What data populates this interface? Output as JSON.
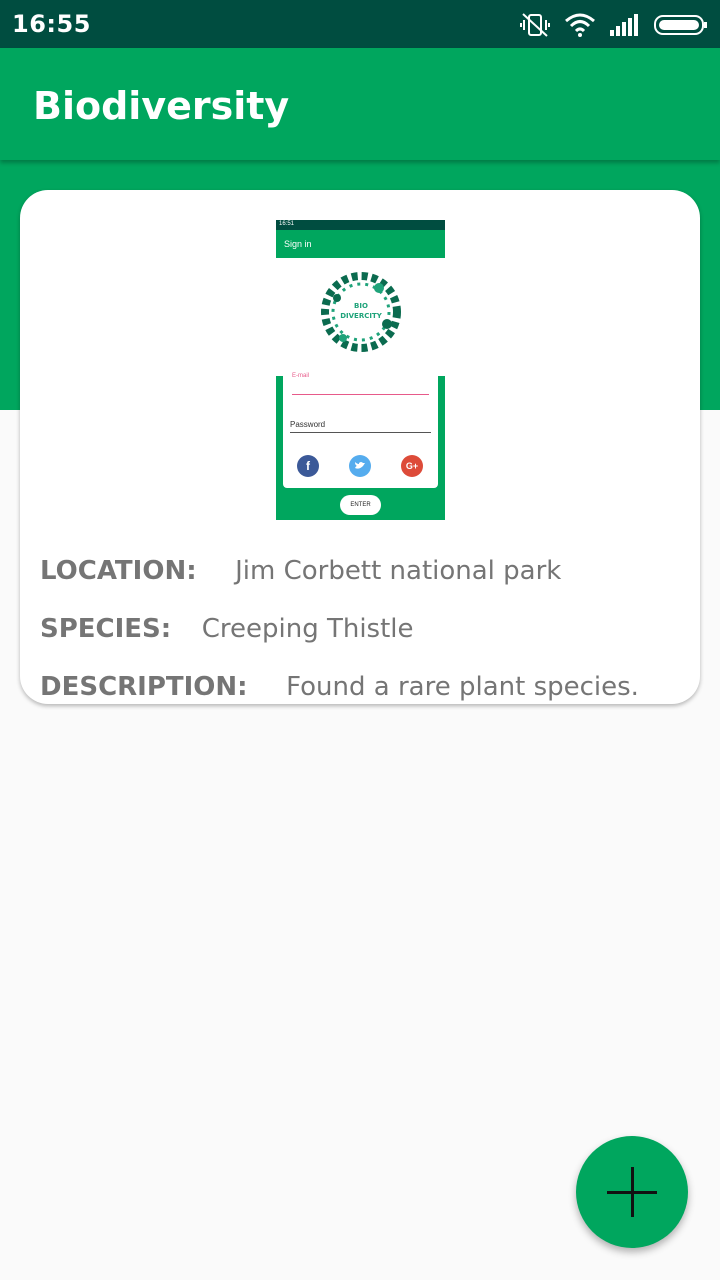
{
  "status_bar": {
    "time": "16:55",
    "icons": [
      "mute-vibrate-icon",
      "wifi-icon",
      "signal-icon",
      "battery-icon"
    ]
  },
  "app_bar": {
    "title": "Biodiversity"
  },
  "colors": {
    "primary": "#00a65e",
    "primary_dark": "#004d40",
    "background": "#fafafa",
    "text_secondary": "#757575"
  },
  "card": {
    "image": {
      "status_time": "16:51",
      "screen_title": "Sign in",
      "logo_text": "BIO DIVERCITY",
      "email_label": "E-mail",
      "password_label": "Password",
      "enter_button": "ENTER",
      "social_icons": [
        "facebook-icon",
        "twitter-icon",
        "google-plus-icon"
      ]
    },
    "location_label": "LOCATION:",
    "location_value": "Jim Corbett national park",
    "species_label": "SPECIES:",
    "species_value": "Creeping Thistle",
    "description_label": "DESCRIPTION:",
    "description_value": "Found a rare plant species."
  },
  "fab": {
    "icon": "add-icon"
  }
}
